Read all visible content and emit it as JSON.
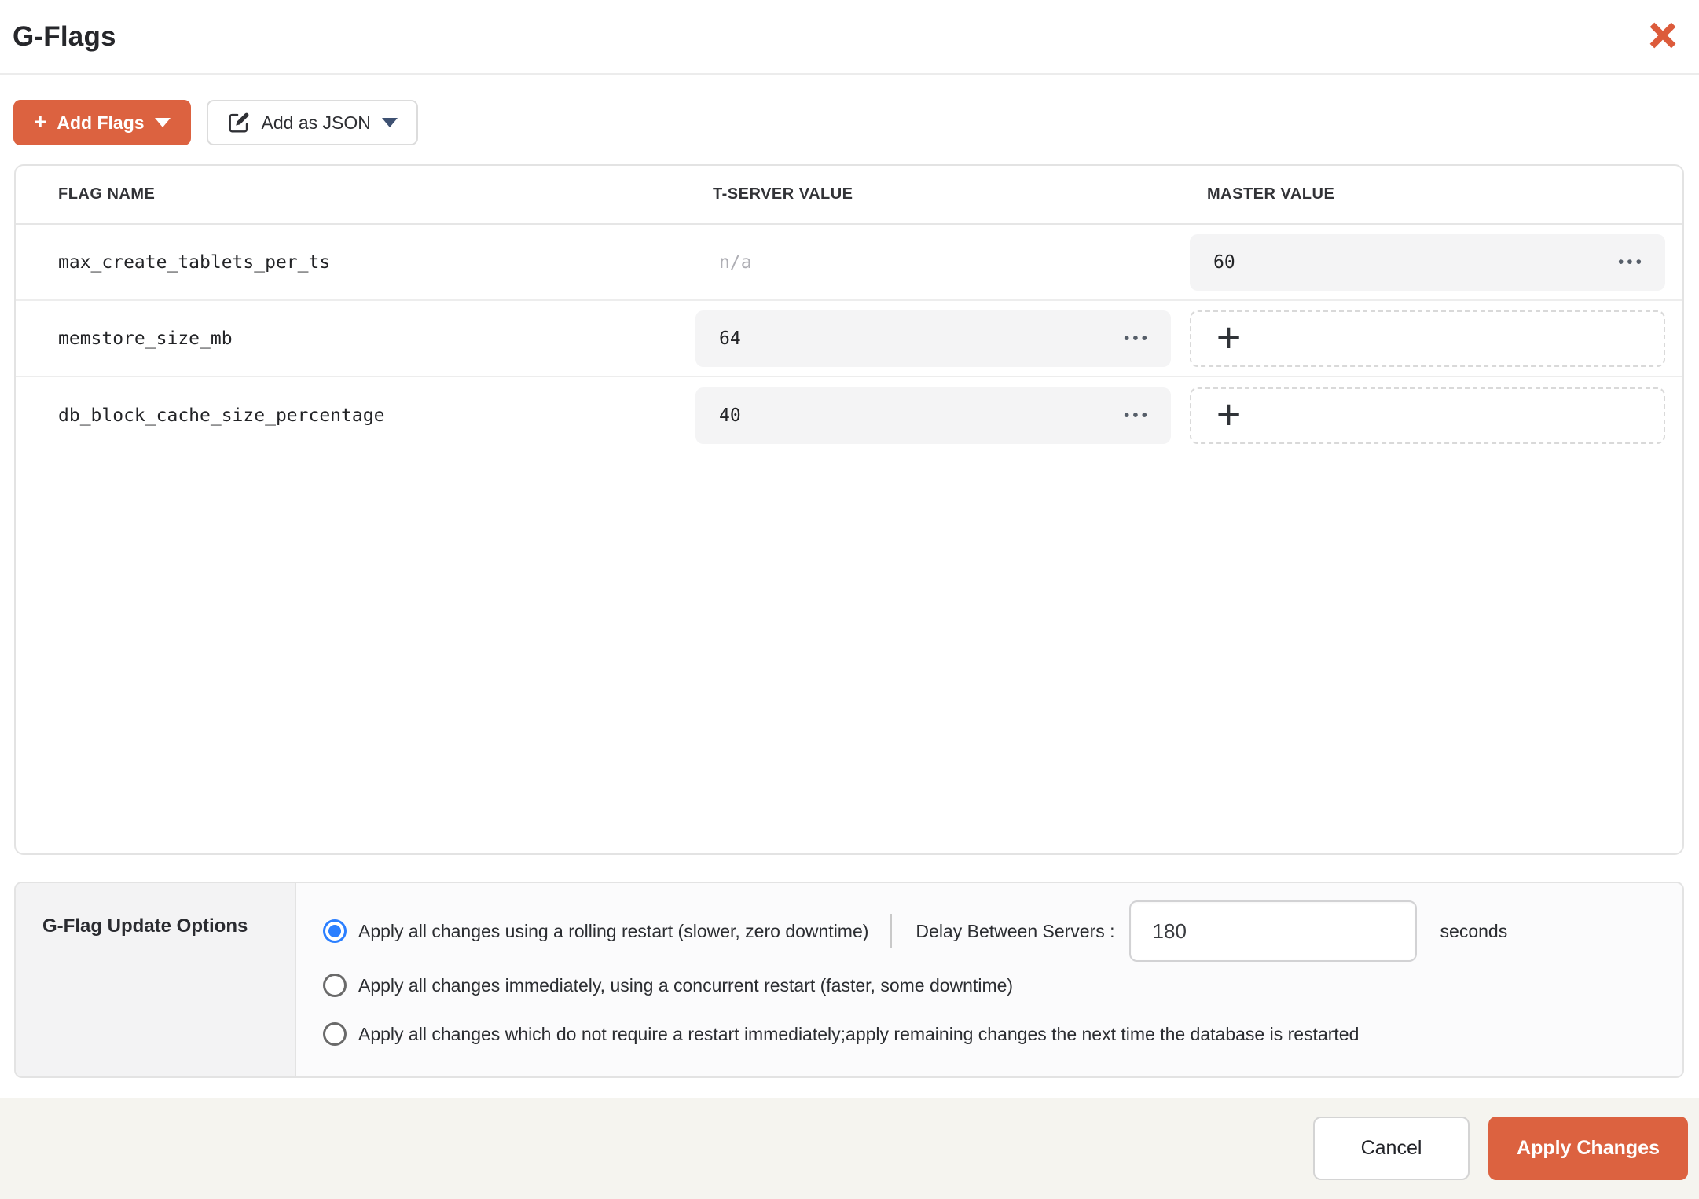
{
  "modal": {
    "title": "G-Flags"
  },
  "toolbar": {
    "add_flags_label": "Add Flags",
    "add_json_label": "Add as JSON"
  },
  "icons": {
    "plus": "+",
    "more": "•••"
  },
  "table": {
    "columns": [
      "FLAG NAME",
      "T-SERVER VALUE",
      "MASTER VALUE"
    ],
    "rows": [
      {
        "name": "max_create_tablets_per_ts",
        "tserver_value": "n/a",
        "master_value": "60"
      },
      {
        "name": "memstore_size_mb",
        "tserver_value": "64",
        "master_value": ""
      },
      {
        "name": "db_block_cache_size_percentage",
        "tserver_value": "40",
        "master_value": ""
      }
    ]
  },
  "options": {
    "title": "G-Flag Update Options",
    "radios": [
      {
        "label": "Apply all changes using a rolling restart (slower, zero downtime)",
        "selected": true
      },
      {
        "label": "Apply all changes immediately, using a concurrent restart (faster, some downtime)",
        "selected": false
      },
      {
        "label": "Apply all changes which do not require a restart immediately;apply remaining changes the next time the database is restarted",
        "selected": false
      }
    ],
    "delay": {
      "label": "Delay Between Servers :",
      "value": "180",
      "unit": "seconds"
    }
  },
  "footer": {
    "cancel_label": "Cancel",
    "apply_label": "Apply Changes"
  },
  "colors": {
    "accent_orange": "#DC6240",
    "radio_blue": "#2B7FFF"
  }
}
